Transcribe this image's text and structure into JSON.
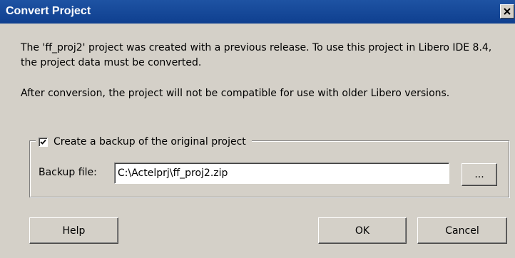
{
  "window": {
    "title": "Convert Project",
    "close_glyph": "×"
  },
  "message": {
    "line_block_1": "The 'ff_proj2' project was created with a previous release. To use this project in Libero IDE 8.4, the project data must be converted.",
    "line_block_2": "After conversion, the project will not be compatible for use with older Libero versions."
  },
  "backup_group": {
    "checkbox_label": "Create a backup of the original project",
    "checked": true,
    "file_label": "Backup file:",
    "file_value": "C:\\Actelprj\\ff_proj2.zip",
    "browse_label": "..."
  },
  "buttons": {
    "help": "Help",
    "ok": "OK",
    "cancel": "Cancel"
  },
  "icons": {
    "close": "close-icon",
    "check": "checkmark-icon"
  },
  "colors": {
    "titlebar": "#0f3f8f",
    "dialog_bg": "#d4d0c8"
  }
}
